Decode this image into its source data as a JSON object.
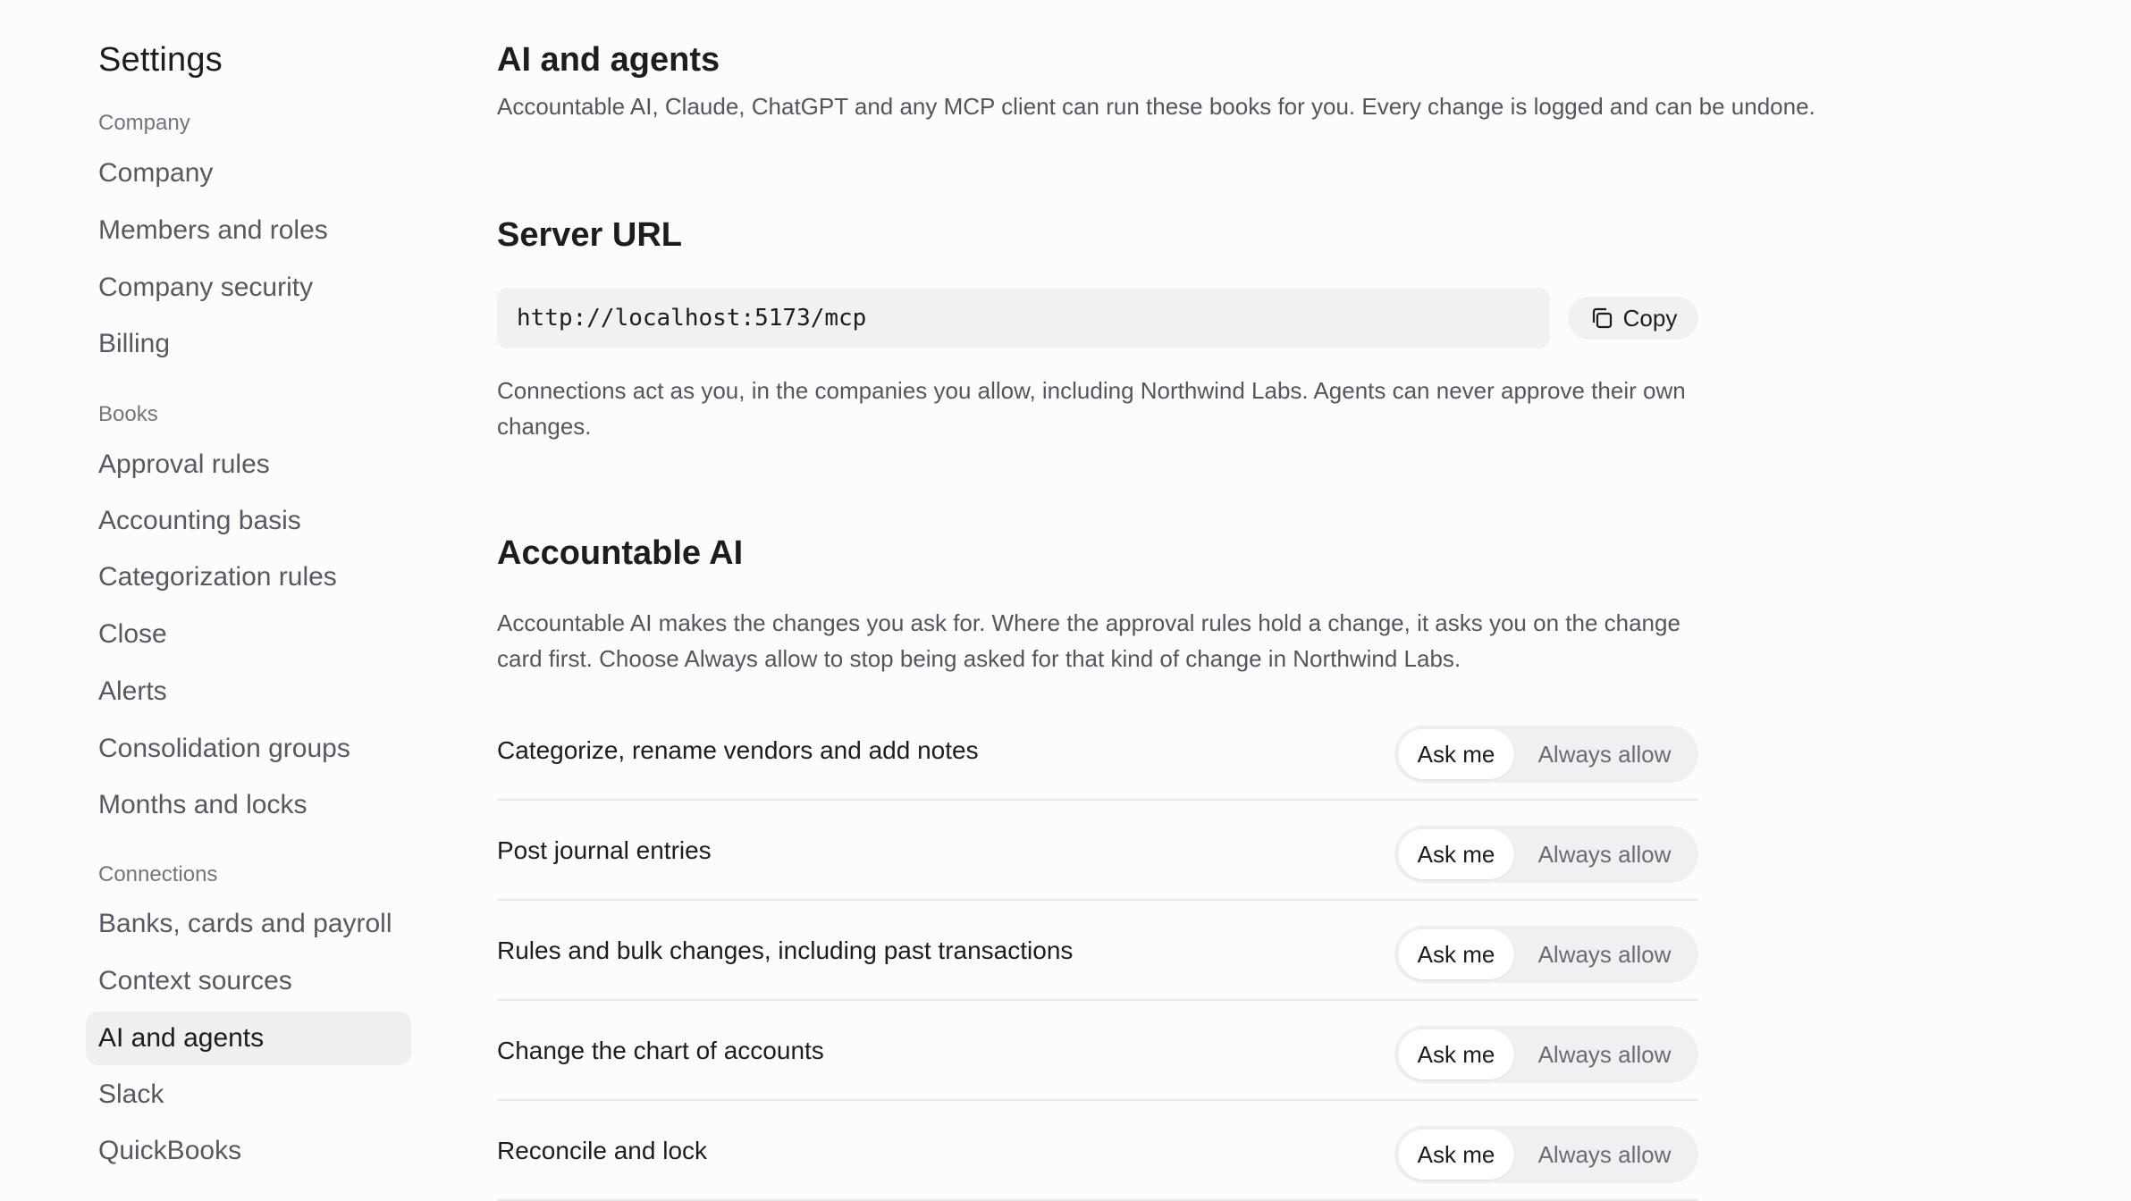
{
  "sidebar": {
    "title": "Settings",
    "sections": [
      {
        "label": "Company",
        "items": [
          "Company",
          "Members and roles",
          "Company security",
          "Billing"
        ]
      },
      {
        "label": "Books",
        "items": [
          "Approval rules",
          "Accounting basis",
          "Categorization rules",
          "Close",
          "Alerts",
          "Consolidation groups",
          "Months and locks"
        ]
      },
      {
        "label": "Connections",
        "items": [
          "Banks, cards and payroll",
          "Context sources",
          "AI and agents",
          "Slack",
          "QuickBooks"
        ]
      }
    ],
    "active_item": "AI and agents"
  },
  "main": {
    "title": "AI and agents",
    "lead": "Accountable AI, Claude, ChatGPT and any MCP client can run these books for you. Every change is logged and can be undone.",
    "server": {
      "heading": "Server URL",
      "url": "http://localhost:5173/mcp",
      "copy_label": "Copy",
      "copy_icon": "copy-icon",
      "note": "Connections act as you, in the companies you allow, including Northwind Labs. Agents can never approve their own changes."
    },
    "ai": {
      "heading": "Accountable AI",
      "description": "Accountable AI makes the changes you ask for. Where the approval rules hold a change, it asks you on the change card first. Choose Always allow to stop being asked for that kind of change in Northwind Labs.",
      "options": {
        "ask": "Ask me",
        "always": "Always allow"
      },
      "permissions": [
        {
          "label": "Categorize, rename vendors and add notes",
          "selected": "Ask me"
        },
        {
          "label": "Post journal entries",
          "selected": "Ask me"
        },
        {
          "label": "Rules and bulk changes, including past transactions",
          "selected": "Ask me"
        },
        {
          "label": "Change the chart of accounts",
          "selected": "Ask me"
        },
        {
          "label": "Reconcile and lock",
          "selected": "Ask me"
        }
      ]
    }
  }
}
